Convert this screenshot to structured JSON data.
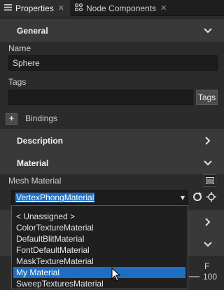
{
  "tabs": [
    {
      "label": "Properties",
      "icon": "properties-icon"
    },
    {
      "label": "Node Components",
      "icon": "node-components-icon"
    }
  ],
  "sections": {
    "general": "General",
    "description": "Description",
    "material": "Material"
  },
  "fields": {
    "name_label": "Name",
    "name_value": "Sphere",
    "tags_label": "Tags",
    "tags_value": "",
    "tags_button": "Tags",
    "bindings_label": "Bindings",
    "mesh_material_label": "Mesh Material",
    "mesh_material_value": "VertexPhongMaterial"
  },
  "dropdown": {
    "items": [
      "< Unassigned >",
      "ColorTextureMaterial",
      "DefaultBlitMaterial",
      "FontDefaultMaterial",
      "MaskTextureMaterial",
      "My Material",
      "SweepTexturesMaterial"
    ],
    "highlighted": "My Material"
  },
  "side_values": {
    "value_100": "100",
    "letter_f": "F"
  },
  "colors": {
    "accent": "#1e6fc4",
    "section_bg": "#393939",
    "panel_bg": "#2b2b2b"
  }
}
